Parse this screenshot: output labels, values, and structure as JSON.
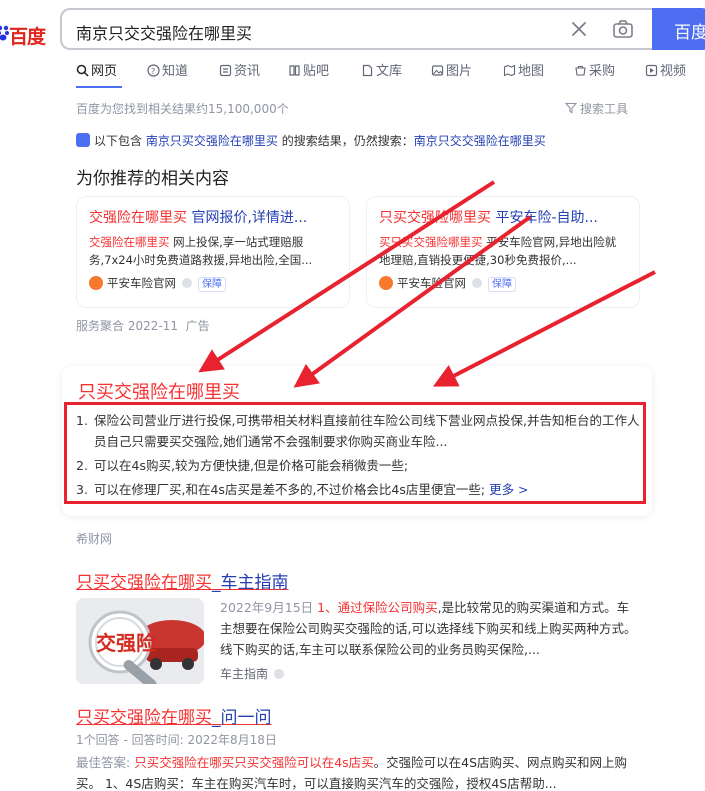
{
  "header": {
    "logo_text": "百度",
    "search_query": "南京只交交强险在哪里买",
    "search_button": "百度"
  },
  "tabs": [
    {
      "label": "网页",
      "icon": "search-icon",
      "active": true
    },
    {
      "label": "知道",
      "icon": "question-icon"
    },
    {
      "label": "资讯",
      "icon": "news-icon"
    },
    {
      "label": "贴吧",
      "icon": "tieba-icon"
    },
    {
      "label": "文库",
      "icon": "doc-icon"
    },
    {
      "label": "图片",
      "icon": "image-icon"
    },
    {
      "label": "地图",
      "icon": "map-icon"
    },
    {
      "label": "采购",
      "icon": "cart-icon"
    },
    {
      "label": "视频",
      "icon": "video-icon"
    }
  ],
  "result_count": "百度为您找到相关结果约15,100,000个",
  "search_tools": "搜索工具",
  "hint": {
    "prefix": "以下包含",
    "query_link": "南京只买交强险在哪里买",
    "middle": "的搜索结果，仍然搜索：",
    "original_link": "南京只交交强险在哪里买"
  },
  "recommend_title": "为你推荐的相关内容",
  "ad_cards": [
    {
      "title_red": "交强险在哪里买",
      "title_rest": " 官网报价,详情进...",
      "desc_red": "交强险在哪里买",
      "desc_rest": " 网上投保,享一站式理赔服务,7x24小时免费道路救援,异地出险,全国...",
      "source": "平安车险官网",
      "badge": "保障"
    },
    {
      "title_red": "只买交强险哪里买",
      "title_rest": " 平安车险-自助...",
      "desc_red": "买只买交强险哪里买",
      "desc_rest": " 平安车险官网,异地出险就地理赔,直销投更便捷,30秒免费报价,...",
      "source": "平安车险官网",
      "badge": "保障"
    }
  ],
  "ad_meta": {
    "source": "服务聚合 2022-11",
    "tag": "广告"
  },
  "answer": {
    "title": "只买交强险在哪里买",
    "items": [
      {
        "num": "1.",
        "text": "保险公司营业厅进行投保,可携带相关材料直接前往车险公司线下营业网点投保,并告知柜台的工作人员自己只需要买交强险,她们通常不会强制要求你购买商业车险..."
      },
      {
        "num": "2.",
        "text": "可以在4s购买,较为方便快捷,但是价格可能会稍微贵一些;"
      },
      {
        "num": "3.",
        "text": "可以在修理厂买,和在4s店买是差不多的,不过价格会比4s店里便宜一些;"
      }
    ],
    "more": "更多 >",
    "source": "希财网"
  },
  "result1": {
    "title_red": "只买交强险在哪买",
    "title_blue": "_车主指南",
    "date": "2022年9月15日",
    "lead_red": "1、通过保险公司购买",
    "text": ",是比较常见的购买渠道和方式。车主想要在保险公司购买交强险的话,可以选择线下购买和线上购买两种方式。线下购买的话,车主可以联系保险公司的业务员购买保险,...",
    "source": "车主指南",
    "thumb_label": "交强险"
  },
  "result2": {
    "title_red": "只买交强险在哪买",
    "title_blue": "_问一问",
    "meta": "1个回答 - 回答时间: 2022年8月18日",
    "label": "最佳答案:",
    "lead_red": "只买交强险在哪买只买交强险可以在4s店买",
    "text": "。交强险可以在4S店购买、网点购买和网上购买。 1、4S店购买：车主在购买汽车时，可以直接购买汽车的交强险，授权4S店帮助..."
  }
}
